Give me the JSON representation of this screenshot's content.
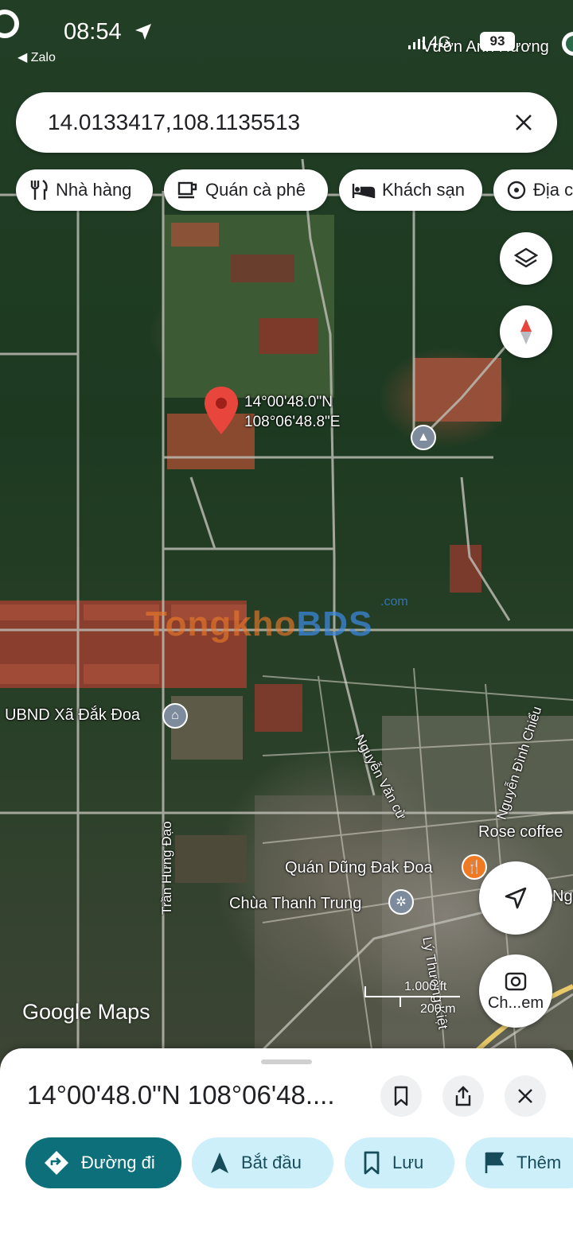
{
  "status_bar": {
    "time": "08:54",
    "back_app": "◀ Zalo",
    "network": "4G",
    "battery": "93"
  },
  "search": {
    "query": "14.0133417,108.1135513"
  },
  "chips": [
    {
      "label": "Nhà hàng",
      "icon": "restaurant-icon"
    },
    {
      "label": "Quán cà phê",
      "icon": "coffee-icon"
    },
    {
      "label": "Khách sạn",
      "icon": "hotel-icon"
    },
    {
      "label": "Địa c",
      "icon": "attractions-icon"
    }
  ],
  "map": {
    "pin": {
      "lat": "14°00'48.0\"N",
      "lng": "108°06'48.8\"E"
    },
    "places": {
      "top_right": "Vườn Anh Hương",
      "ubnd": "UBND Xã Đắk Đoa",
      "quan_dung": "Quán Dũng Đak Đoa",
      "chua": "Chùa Thanh Trung",
      "rose": "Rose coffee",
      "edge_right": "Nguy"
    },
    "streets": {
      "tran_hung_dao": "Trần Hưng Đạo",
      "nguyen_van_cu": "Nguyễn Văn cừ",
      "nguyen_dinh_chieu": "Nguyễn Đình Chiểu",
      "ly_thuong_kiet": "Lý Thường Kiệt"
    },
    "scale": {
      "primary": "1.000 ft",
      "secondary": "200 m"
    },
    "watermark": {
      "part1": "Tongkho",
      "part2": "BDS",
      "suffix": ".com"
    },
    "logo": "Google Maps",
    "camera_label": "Ch...em"
  },
  "sheet": {
    "title": "14°00'48.0\"N 108°06'48....",
    "actions": [
      {
        "label": "Đường đi",
        "icon": "directions-icon"
      },
      {
        "label": "Bắt đầu",
        "icon": "navigation-icon"
      },
      {
        "label": "Lưu",
        "icon": "bookmark-icon"
      },
      {
        "label": "Thêm",
        "icon": "flag-icon"
      }
    ]
  },
  "colors": {
    "primary_action": "#0c6f7a",
    "secondary_action": "#cdeffa",
    "pin": "#e8453c"
  }
}
